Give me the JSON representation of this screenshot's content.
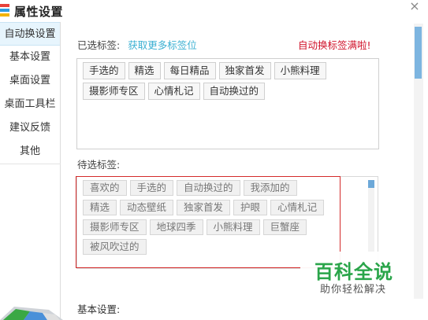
{
  "window": {
    "title": "属性设置",
    "close_label": "×",
    "app_icon": "app-logo-icon",
    "close_icon": "close-icon"
  },
  "sidebar": {
    "items": [
      {
        "label": "自动换设置",
        "active": true
      },
      {
        "label": "基本设置",
        "active": false
      },
      {
        "label": "桌面设置",
        "active": false
      },
      {
        "label": "桌面工具栏",
        "active": false
      },
      {
        "label": "建议反馈",
        "active": false
      },
      {
        "label": "其他",
        "active": false
      }
    ]
  },
  "selected_tags": {
    "label": "已选标签:",
    "more_link": "获取更多标签位",
    "warning": "自动换标签满啦!",
    "tags": [
      "手选的",
      "精选",
      "每日精品",
      "独家首发",
      "小熊料理",
      "摄影师专区",
      "心情札记",
      "自动换过的"
    ]
  },
  "pending_tags": {
    "label": "待选标签:",
    "tags": [
      "喜欢的",
      "手选的",
      "自动换过的",
      "我添加的",
      "精选",
      "动态壁纸",
      "独家首发",
      "护眼",
      "心情札记",
      "摄影师专区",
      "地球四季",
      "小熊料理",
      "巨蟹座",
      "被风吹过的"
    ]
  },
  "basic_section": {
    "label": "基本设置:"
  },
  "watermark": {
    "title": "百科全说",
    "subtitle": "助你轻松解决"
  },
  "colors": {
    "accent_link": "#3bb0d2",
    "warning": "#d0122a",
    "highlight_frame": "#d42b2b",
    "watermark_green": "#2aa54a",
    "sidebar_active": "#e7f5fd",
    "scrollbar_thumb": "#7db5e0"
  }
}
